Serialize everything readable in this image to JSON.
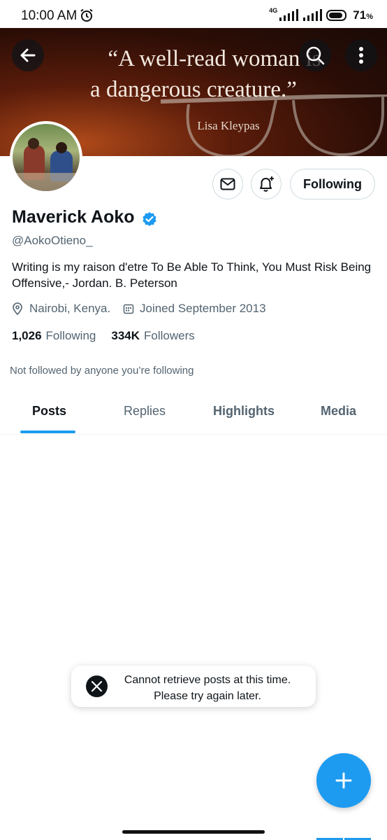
{
  "status_bar": {
    "time": "10:00 AM",
    "network": "4G",
    "battery": "71",
    "battery_unit": "%"
  },
  "banner": {
    "quote_line1": "“A well-read woman is",
    "quote_line2": "a dangerous creature.”",
    "quote_author": "Lisa Kleypas"
  },
  "actions": {
    "following_label": "Following"
  },
  "profile": {
    "name": "Maverick Aoko",
    "handle": "@AokoOtieno_",
    "bio": "Writing is my raison d'etre  To Be Able To Think, You Must Risk Being Offensive,- Jordan. B. Peterson",
    "location": "Nairobi, Kenya.",
    "joined": "Joined September 2013",
    "following_count": "1,026",
    "following_label": "Following",
    "followers_count": "334K",
    "followers_label": "Followers",
    "not_followed_note": "Not followed by anyone you’re following"
  },
  "tabs": [
    {
      "label": "Posts"
    },
    {
      "label": "Replies"
    },
    {
      "label": "Highlights"
    },
    {
      "label": "Media"
    }
  ],
  "toast": {
    "line1": "Cannot retrieve posts at this time.",
    "line2": "Please try again later."
  },
  "colors": {
    "accent": "#1d9bf0",
    "text_primary": "#0f1419",
    "text_secondary": "#536471"
  },
  "icons": [
    "back-arrow-icon",
    "search-icon",
    "more-vert-icon",
    "mail-icon",
    "bell-plus-icon",
    "verified-badge-icon",
    "location-pin-icon",
    "calendar-icon",
    "x-logo-icon",
    "plus-icon"
  ]
}
